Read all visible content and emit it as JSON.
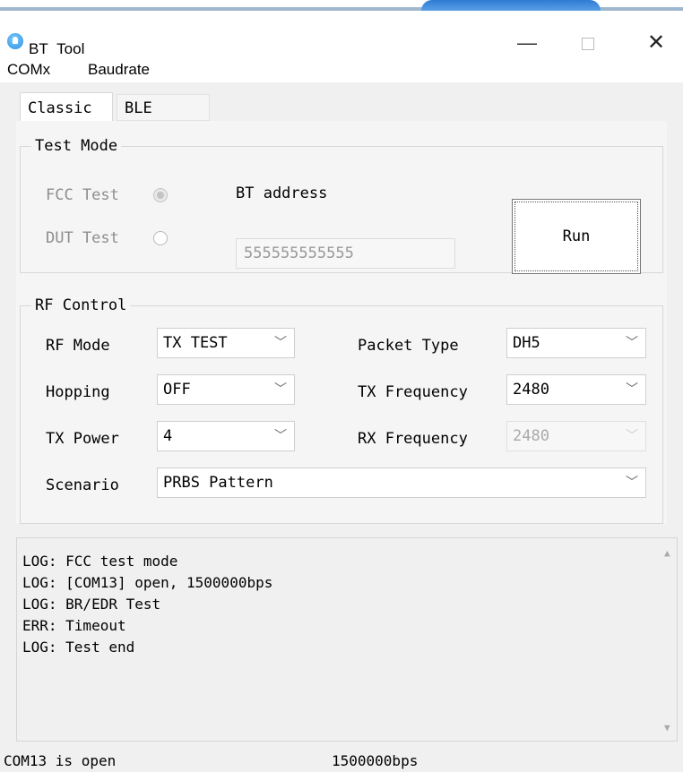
{
  "window": {
    "title": "BT_Tool"
  },
  "menu": {
    "items": [
      "COMx",
      "Baudrate"
    ]
  },
  "tabs": {
    "classic": "Classic",
    "ble": "BLE"
  },
  "test_mode": {
    "legend": "Test Mode",
    "fcc_label": "FCC Test",
    "dut_label": "DUT Test",
    "bt_address_label": "BT address",
    "bt_address_value": "555555555555",
    "run_label": "Run"
  },
  "rf_control": {
    "legend": "RF Control",
    "rf_mode_label": "RF Mode",
    "rf_mode_value": "TX TEST",
    "hopping_label": "Hopping",
    "hopping_value": "OFF",
    "tx_power_label": "TX Power",
    "tx_power_value": "4",
    "packet_type_label": "Packet Type",
    "packet_type_value": "DH5",
    "tx_freq_label": "TX Frequency",
    "tx_freq_value": "2480",
    "rx_freq_label": "RX Frequency",
    "rx_freq_value": "2480",
    "scenario_label": "Scenario",
    "scenario_value": "PRBS Pattern"
  },
  "log": {
    "lines": [
      "LOG: FCC test mode",
      "LOG: [COM13] open, 1500000bps",
      "LOG: BR/EDR Test",
      "ERR: Timeout",
      "LOG: Test end"
    ]
  },
  "status": {
    "port": "COM13 is open",
    "baud": "1500000bps"
  },
  "icons": {
    "chevron": "chevron-down-icon",
    "app": "bluetooth-tool-icon"
  }
}
